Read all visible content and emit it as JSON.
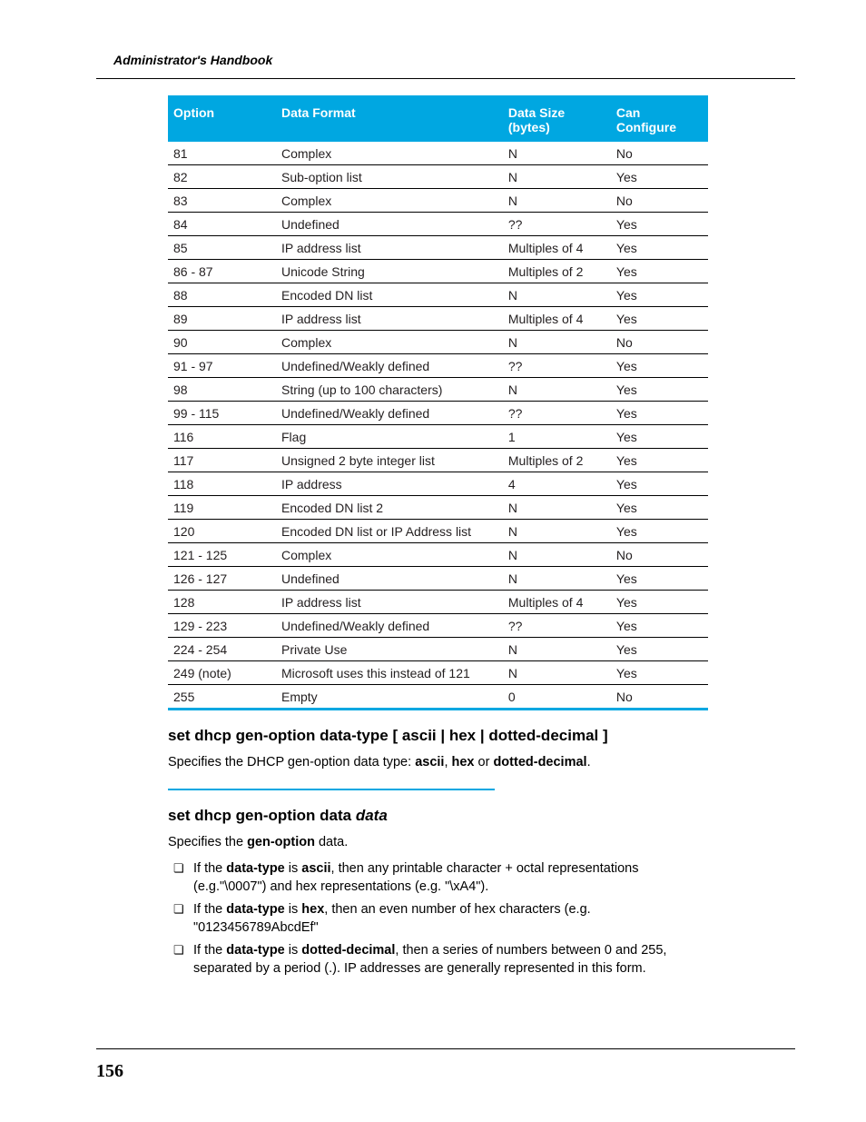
{
  "doc": {
    "header_title": "Administrator's Handbook",
    "page_number": "156"
  },
  "table": {
    "headers": {
      "option": "Option",
      "format": "Data Format",
      "size_line1": "Data Size",
      "size_line2": "(bytes)",
      "conf_line1": "Can",
      "conf_line2": "Configure"
    },
    "rows": [
      {
        "option": "81",
        "format": "Complex",
        "size": "N",
        "conf": "No"
      },
      {
        "option": "82",
        "format": "Sub-option list",
        "size": "N",
        "conf": "Yes"
      },
      {
        "option": "83",
        "format": "Complex",
        "size": "N",
        "conf": "No"
      },
      {
        "option": "84",
        "format": "Undefined",
        "size": "??",
        "conf": "Yes"
      },
      {
        "option": "85",
        "format": "IP address list",
        "size": "Multiples of 4",
        "conf": "Yes"
      },
      {
        "option": "86 - 87",
        "format": "Unicode String",
        "size": "Multiples of 2",
        "conf": "Yes"
      },
      {
        "option": "88",
        "format": "Encoded DN list",
        "size": "N",
        "conf": "Yes"
      },
      {
        "option": "89",
        "format": "IP address list",
        "size": "Multiples of 4",
        "conf": "Yes"
      },
      {
        "option": "90",
        "format": "Complex",
        "size": "N",
        "conf": "No"
      },
      {
        "option": "91 - 97",
        "format": "Undefined/Weakly defined",
        "size": "??",
        "conf": "Yes"
      },
      {
        "option": "98",
        "format": "String (up to 100 characters)",
        "size": "N",
        "conf": "Yes"
      },
      {
        "option": "99 - 115",
        "format": "Undefined/Weakly defined",
        "size": "??",
        "conf": "Yes"
      },
      {
        "option": "116",
        "format": "Flag",
        "size": "1",
        "conf": "Yes"
      },
      {
        "option": "117",
        "format": "Unsigned 2 byte integer list",
        "size": "Multiples of 2",
        "conf": "Yes"
      },
      {
        "option": "118",
        "format": "IP address",
        "size": "4",
        "conf": "Yes"
      },
      {
        "option": "119",
        "format": "Encoded DN list 2",
        "size": "N",
        "conf": "Yes"
      },
      {
        "option": "120",
        "format": "Encoded DN list or IP Address list",
        "size": "N",
        "conf": "Yes"
      },
      {
        "option": "121 - 125",
        "format": "Complex",
        "size": "N",
        "conf": "No"
      },
      {
        "option": "126 - 127",
        "format": "Undefined",
        "size": "N",
        "conf": "Yes"
      },
      {
        "option": "128",
        "format": "IP address list",
        "size": "Multiples of 4",
        "conf": "Yes"
      },
      {
        "option": "129 - 223",
        "format": "Undefined/Weakly defined",
        "size": "??",
        "conf": "Yes"
      },
      {
        "option": "224 - 254",
        "format": "Private Use",
        "size": "N",
        "conf": "Yes"
      },
      {
        "option": "249 (note)",
        "format": "Microsoft uses this instead of 121",
        "size": "N",
        "conf": "Yes"
      },
      {
        "option": "255",
        "format": "Empty",
        "size": "0",
        "conf": "No"
      }
    ]
  },
  "section1": {
    "heading": "set dhcp gen-option data-type [ ascii | hex | dotted-decimal ]",
    "para_pre": "Specifies the DHCP gen-option data type: ",
    "b1": "ascii",
    "sep1": ", ",
    "b2": "hex",
    "sep2": " or ",
    "b3": "dotted-decimal",
    "end": "."
  },
  "section2": {
    "heading_plain": "set dhcp gen-option data ",
    "heading_italic": "data",
    "para_pre": "Specifies the ",
    "para_b": "gen-option",
    "para_post": " data.",
    "bullets": [
      {
        "pre": "If the ",
        "b1": "data-type",
        "mid1": " is ",
        "b2": "ascii",
        "post": ", then any printable character + octal representations (e.g.\"\\0007\") and hex representations (e.g. \"\\xA4\")."
      },
      {
        "pre": "If the ",
        "b1": "data-type",
        "mid1": " is ",
        "b2": "hex",
        "post": ", then an even number of hex characters (e.g. \"0123456789AbcdEf\""
      },
      {
        "pre": "If the ",
        "b1": "data-type",
        "mid1": " is ",
        "b2": "dotted-decimal",
        "post": ", then a series of numbers between 0 and 255, separated by a period (.). IP addresses are generally represented in this form."
      }
    ]
  }
}
